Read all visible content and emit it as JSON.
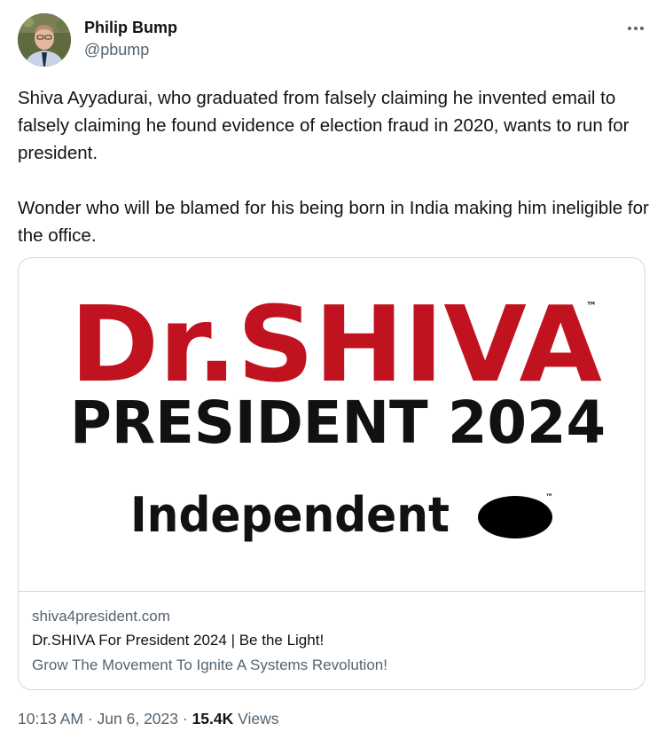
{
  "author": {
    "name": "Philip Bump",
    "handle": "@pbump"
  },
  "tweet": {
    "paragraphs": [
      "Shiva Ayyadurai, who graduated from falsely claiming he invented email to falsely claiming he found evidence of election fraud in 2020, wants to run for president.",
      "Wonder who will be blamed for his being born in India making him ineligible for the office."
    ]
  },
  "card": {
    "image": {
      "headline": "Dr.SHIVA",
      "headline_tm": "™",
      "subheadline": "PRESIDENT 2024",
      "party": "Independent",
      "party_tm": "™",
      "headline_color": "#c1121f",
      "text_color": "#111111"
    },
    "domain": "shiva4president.com",
    "title": "Dr.SHIVA For President 2024 | Be the Light!",
    "description": "Grow The Movement To Ignite A Systems Revolution!"
  },
  "meta": {
    "time": "10:13 AM",
    "separator": "·",
    "date": "Jun 6, 2023",
    "separator2": "·",
    "views_count": "15.4K",
    "views_label": "Views"
  },
  "icons": {
    "more": "more-dots-icon",
    "avatar": "profile-photo"
  },
  "colors": {
    "text_primary": "#0f1419",
    "text_secondary": "#536471",
    "border": "#cfd9de"
  }
}
